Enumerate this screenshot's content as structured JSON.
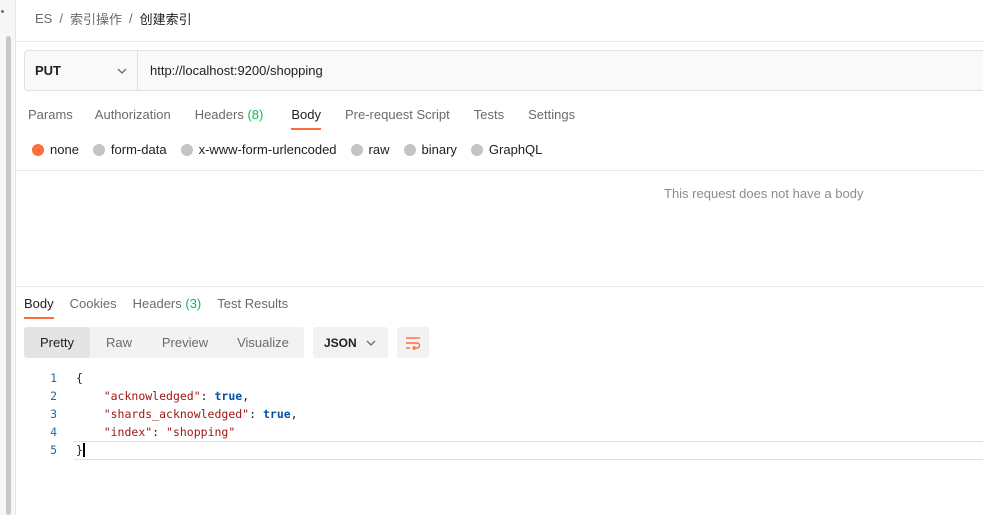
{
  "breadcrumb": {
    "collection": "ES",
    "folder": "索引操作",
    "request": "创建索引",
    "separator": "/"
  },
  "request": {
    "method": "PUT",
    "url": "http://localhost:9200/shopping",
    "tabs": [
      {
        "label": "Params",
        "count": "",
        "active": false
      },
      {
        "label": "Authorization",
        "count": "",
        "active": false
      },
      {
        "label": "Headers",
        "count": "(8)",
        "active": false
      },
      {
        "label": "Body",
        "count": "",
        "active": true
      },
      {
        "label": "Pre-request Script",
        "count": "",
        "active": false
      },
      {
        "label": "Tests",
        "count": "",
        "active": false
      },
      {
        "label": "Settings",
        "count": "",
        "active": false
      }
    ],
    "body_types": [
      {
        "label": "none",
        "selected": true
      },
      {
        "label": "form-data",
        "selected": false
      },
      {
        "label": "x-www-form-urlencoded",
        "selected": false
      },
      {
        "label": "raw",
        "selected": false
      },
      {
        "label": "binary",
        "selected": false
      },
      {
        "label": "GraphQL",
        "selected": false
      }
    ],
    "empty_body_message": "This request does not have a body"
  },
  "response": {
    "tabs": [
      {
        "label": "Body",
        "count": "",
        "active": true
      },
      {
        "label": "Cookies",
        "count": "",
        "active": false
      },
      {
        "label": "Headers",
        "count": "(3)",
        "active": false
      },
      {
        "label": "Test Results",
        "count": "",
        "active": false
      }
    ],
    "view_modes": [
      {
        "label": "Pretty",
        "active": true
      },
      {
        "label": "Raw",
        "active": false
      },
      {
        "label": "Preview",
        "active": false
      },
      {
        "label": "Visualize",
        "active": false
      }
    ],
    "format": "JSON",
    "code_lines": [
      {
        "num": "1",
        "text": "{"
      },
      {
        "num": "2",
        "key": "\"acknowledged\"",
        "value": "true",
        "value_type": "kw",
        "trail": ","
      },
      {
        "num": "3",
        "key": "\"shards_acknowledged\"",
        "value": "true",
        "value_type": "kw",
        "trail": ","
      },
      {
        "num": "4",
        "key": "\"index\"",
        "value": "\"shopping\"",
        "value_type": "str",
        "trail": ""
      },
      {
        "num": "5",
        "text": "}"
      }
    ]
  },
  "colors": {
    "accent": "#ff6c37",
    "count": "#0cbb52",
    "json_key": "#a31515",
    "json_keyword": "#0451a5"
  }
}
